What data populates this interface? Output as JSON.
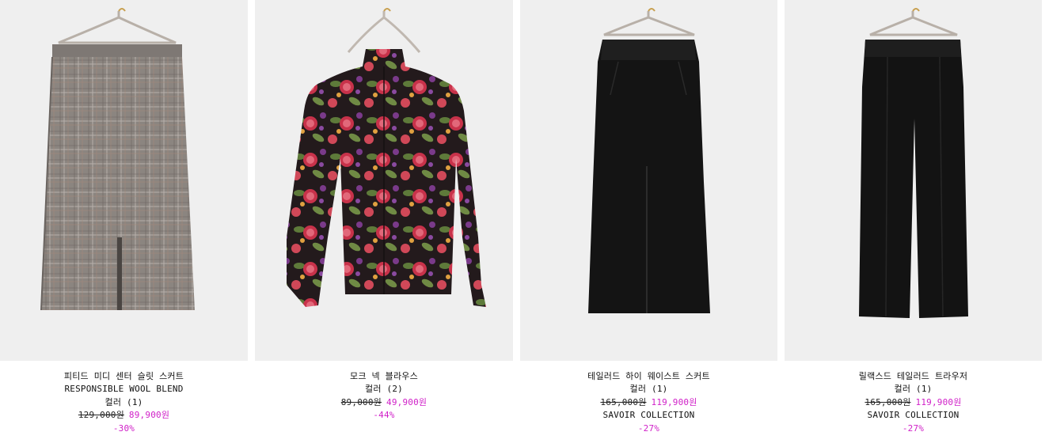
{
  "products": [
    {
      "name": "피티드 미디 센터 슬릿 스커트",
      "collection": "RESPONSIBLE WOOL BLEND",
      "colors": "컬러 (1)",
      "original_price": "129,000원",
      "sale_price": "89,900원",
      "discount": "-30%",
      "image": "grey-check-pencil-skirt"
    },
    {
      "name": "모크 넥 블라우스",
      "colors": "컬러 (2)",
      "original_price": "89,000원",
      "sale_price": "49,900원",
      "discount": "-44%",
      "image": "floral-print-mock-neck-blouse"
    },
    {
      "name": "테일러드 하이 웨이스트 스커트",
      "colors": "컬러 (1)",
      "original_price": "165,000원",
      "sale_price": "119,900원",
      "collection": "SAVOIR COLLECTION",
      "discount": "-27%",
      "image": "black-high-waist-maxi-skirt"
    },
    {
      "name": "릴랙스드 테일러드 트라우저",
      "colors": "컬러 (1)",
      "original_price": "165,000원",
      "sale_price": "119,900원",
      "collection": "SAVOIR COLLECTION",
      "discount": "-27%",
      "image": "black-relaxed-trousers"
    }
  ],
  "colors": {
    "sale": "#d020c8",
    "photo_background": "#efefef"
  }
}
